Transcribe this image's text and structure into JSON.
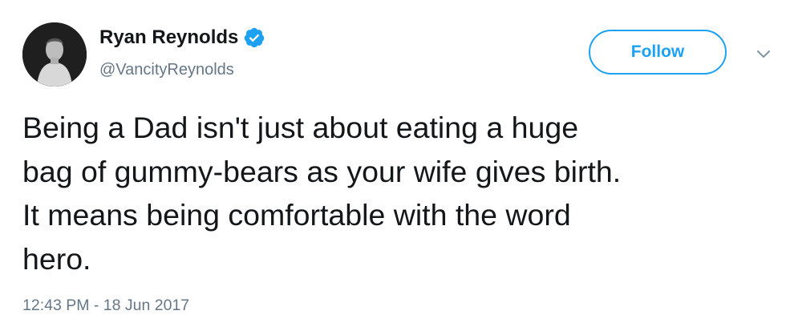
{
  "tweet": {
    "author": {
      "display_name": "Ryan Reynolds",
      "handle": "@VancityReynolds",
      "verified": true
    },
    "follow_label": "Follow",
    "text": "Being a Dad isn't just about eating a huge\nbag of gummy-bears as your wife gives birth.\nIt means being comfortable with the word\nhero.",
    "timestamp": "12:43 PM - 18 Jun 2017"
  },
  "icons": {
    "verified": "verified-badge-icon",
    "caret": "chevron-down-icon"
  },
  "colors": {
    "accent": "#1da1f2",
    "text": "#14171a",
    "secondary": "#657786"
  }
}
